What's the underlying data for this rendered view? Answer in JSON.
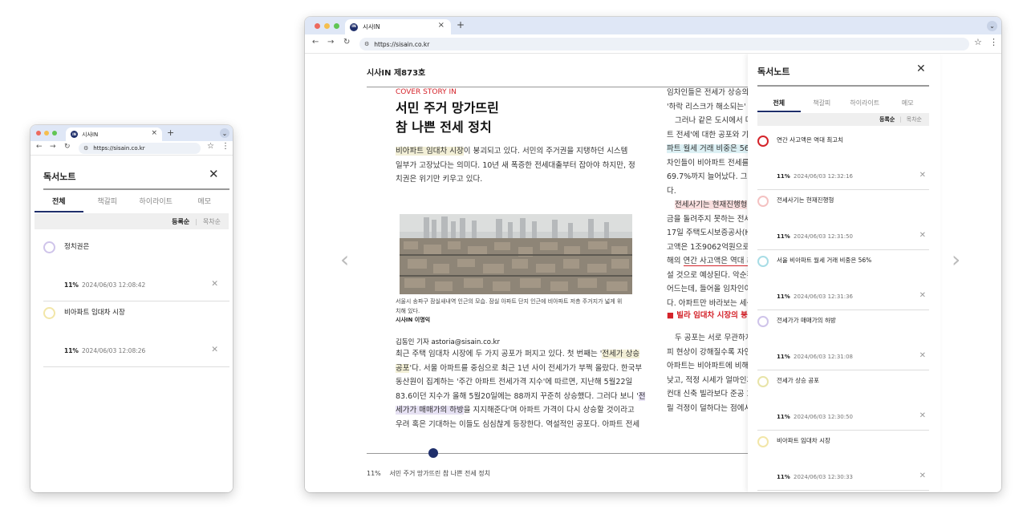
{
  "browser": {
    "tab_title": "시사IN",
    "favicon_label": "IN",
    "url": "https://sisain.co.kr",
    "tab_close": "×",
    "new_tab": "+",
    "back": "←",
    "forward": "→",
    "reload": "↻",
    "star": "☆",
    "menu": "⋮",
    "chevron": "⌄"
  },
  "colors": {
    "accent": "#1f2f6b",
    "red": "#d4232a",
    "dot_red": "#ed6a5e",
    "dot_yellow": "#f5bf4f",
    "dot_green": "#61c554"
  },
  "notes_panel": {
    "title": "독서노트",
    "close": "✕",
    "tabs": [
      "전체",
      "책갈피",
      "하이라이트",
      "메모"
    ],
    "sort_active": "등록순",
    "sort_inactive": "목차순",
    "delete": "✕"
  },
  "small_notes": [
    {
      "text": "정치권은",
      "percent": "11%",
      "date": "2024/06/03 12:08:42",
      "color": "#cfc4ea"
    },
    {
      "text": "비아파트 임대차 시장",
      "percent": "11%",
      "date": "2024/06/03 12:08:26",
      "color": "#f2e6a8"
    }
  ],
  "large_notes": [
    {
      "text": "연간 사고액은 역대 최고치",
      "percent": "11%",
      "date": "2024/06/03 12:32:16",
      "color": "#d4232a"
    },
    {
      "text": "전세사기는 현재진행형",
      "percent": "11%",
      "date": "2024/06/03 12:31:50",
      "color": "#f4c2c2"
    },
    {
      "text": "서울 비아파트 월세 거래 비중은 56%",
      "percent": "11%",
      "date": "2024/06/03 12:31:36",
      "color": "#a8dde6"
    },
    {
      "text": "전세가가 매매가의 하방",
      "percent": "11%",
      "date": "2024/06/03 12:31:08",
      "color": "#cfc4ea"
    },
    {
      "text": "전세가 상승 공포",
      "percent": "11%",
      "date": "2024/06/03 12:30:50",
      "color": "#e8e4a8"
    },
    {
      "text": "비아파트 임대차 시장",
      "percent": "11%",
      "date": "2024/06/03 12:30:33",
      "color": "#f2e6a8"
    }
  ],
  "article": {
    "magazine": "시사IN 제873호",
    "kicker": "COVER STORY IN",
    "headline_1": "서민 주거 망가뜨린",
    "headline_2": "참 나쁜 전세 정치",
    "lead_hl": "비아파트 임대차 시장",
    "lead_1_rest": "이 붕괴되고 있다. 서민의 주거권을 지탱하던 시스템",
    "lead_2": "일부가 고장났다는 의미다. 10년 새 폭증한 전세대출부터 잡아야 하지만, 정",
    "lead_3": "치권은 위기만 키우고 있다.",
    "caption_1": "서울시 송파구 잠실새내역 인근의 모습. 잠실 아파트 단지 인근에 비아파트 저층 주거지가 넓게 위",
    "caption_2": "치해 있다.",
    "credit": "시사IN 이명익",
    "byline": "김동인 기자 astoria@sisain.co.kr",
    "b1_a": "최근 주택 임대차 시장에 두 가지 공포가 퍼지고 있다. 첫 번째는 '",
    "b1_hl": "전세가 상승",
    "b2_hl": "공포",
    "b2_rest": "'다. 서울 아파트를 중심으로 최근 1년 사이 전세가가 부쩍 올랐다. 한국부",
    "b3": "동산원이 집계하는 '주간 아파트 전세가격 지수'에 따르면, 지난해 5월22일",
    "b4_a": "83.6이던 지수가 올해 5월20일에는 88까지 꾸준히 상승했다. 그러다 보니 '",
    "b4_hl": "전",
    "b5_hl": "세가가 매매가의 하방",
    "b5_rest": "을 지지해준다'며 아파트 가격이 다시 상승할 것이라고",
    "b6": "우려 혹은 기대하는 이들도 심심찮게 등장한다. 역설적인 공포다. 아파트 전세",
    "c1": "임차인들은 전세가 상승의",
    "c2": "'하락 리스크가 해소되는' 공",
    "c3": "그러나 같은 도시에서 다",
    "c4": "트 전세'에 대한 공포와 기",
    "c5_hl": "파트 월세 거래 비중은 56%",
    "c6": "차인들이 비아파트 전세를",
    "c7": "69.7%까지 늘어났다. 그만",
    "c8": "다.",
    "c9_hl": "전세사기는 현재진행형",
    "c9_rest": "이",
    "c10": "금을 돌려주지 못하는 전세",
    "c11": "17일 주택도시보증공사(H",
    "c12": "고액은 1조9062억원으로",
    "c13_a": "해의 ",
    "c13_ul": "연간 사고액은 역대 최",
    "c14": "설 것으로 예상된다. 악순환",
    "c15": "어드는데, 들어올 임차인이",
    "c16": "다. 아파트만 바라보는 세상",
    "subhead": "■ 빌라 임대차 시장의 붕괴",
    "c17": "두 공포는 서로 무관하지",
    "c18": "피 현상이 강해질수록 자연",
    "c19": "아파트는 비아파트에 비해",
    "c20": "낮고, 적정 시세가 얼마인지",
    "c21": "컨대 신축 빌라보다 준공 3",
    "c22": "릴 걱정이 덜하다는 점에서",
    "prev_arrow": "‹",
    "next_arrow": "›",
    "progress": 0.11,
    "footer_percent": "11%",
    "footer_title": "서민 주거 망가뜨린 참 나쁜 전세 정치"
  }
}
